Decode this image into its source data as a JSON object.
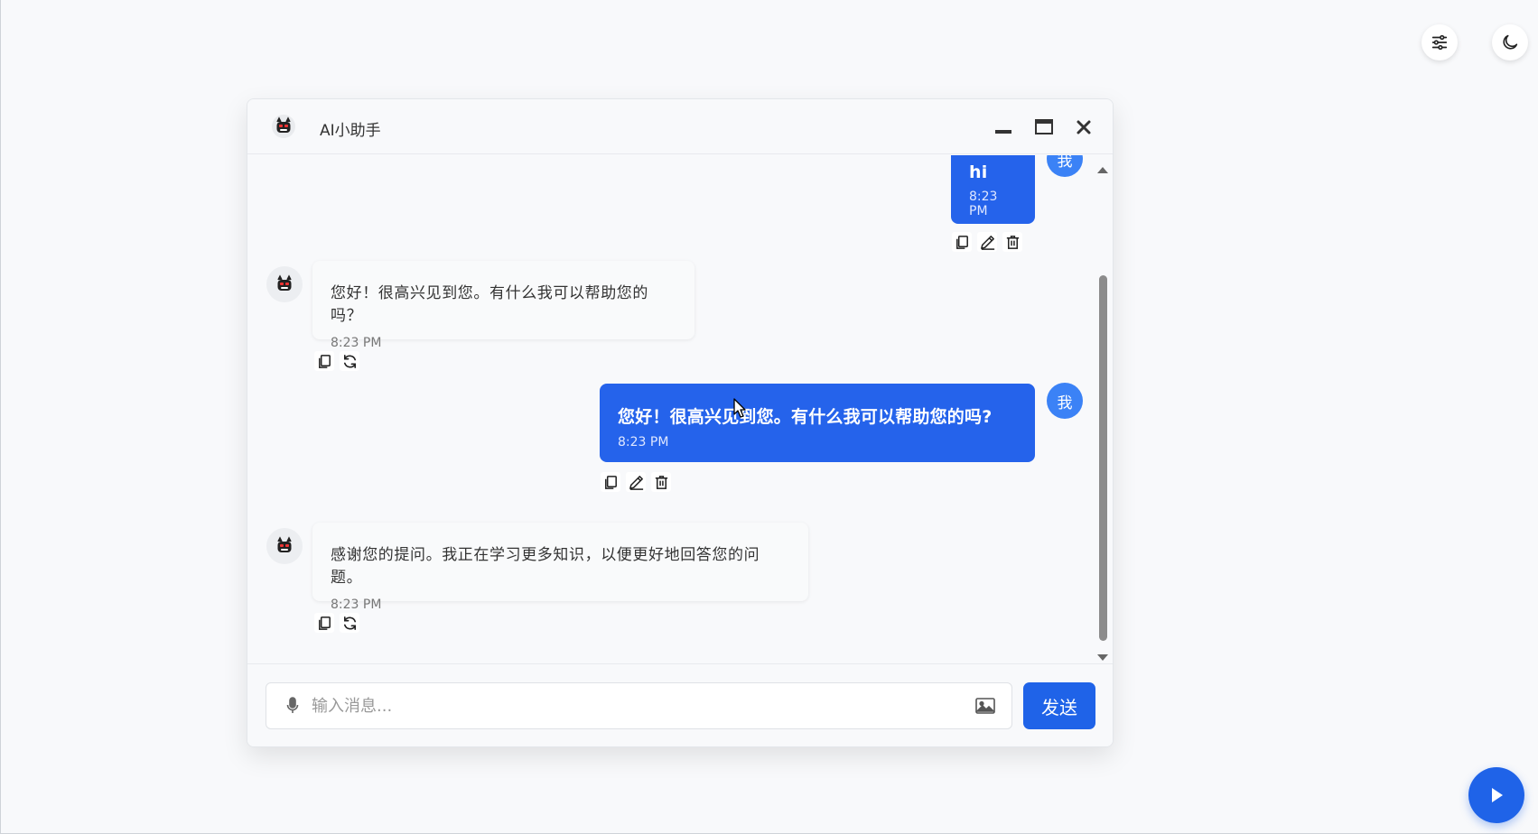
{
  "window": {
    "title": "AI小助手"
  },
  "messages": [
    {
      "role": "user",
      "avatar_label": "我",
      "text": "hi",
      "time": "8:23 PM"
    },
    {
      "role": "bot",
      "text": "您好！很高兴见到您。有什么我可以帮助您的吗？",
      "time": "8:23 PM"
    },
    {
      "role": "user",
      "avatar_label": "我",
      "text": "您好！很高兴见到您。有什么我可以帮助您的吗?",
      "time": "8:23 PM"
    },
    {
      "role": "bot",
      "text": "感谢您的提问。我正在学习更多知识，以便更好地回答您的问题。",
      "time": "8:23 PM"
    }
  ],
  "input": {
    "placeholder": "输入消息...",
    "value": ""
  },
  "send": {
    "label": "发送"
  },
  "icons": {
    "settings": "sliders-icon",
    "theme": "moon-icon",
    "play": "play-icon"
  },
  "colors": {
    "accent": "#2563eb",
    "send_button": "#1f63e8",
    "user_avatar": "#3b82f6",
    "background": "#f8f9fb"
  }
}
